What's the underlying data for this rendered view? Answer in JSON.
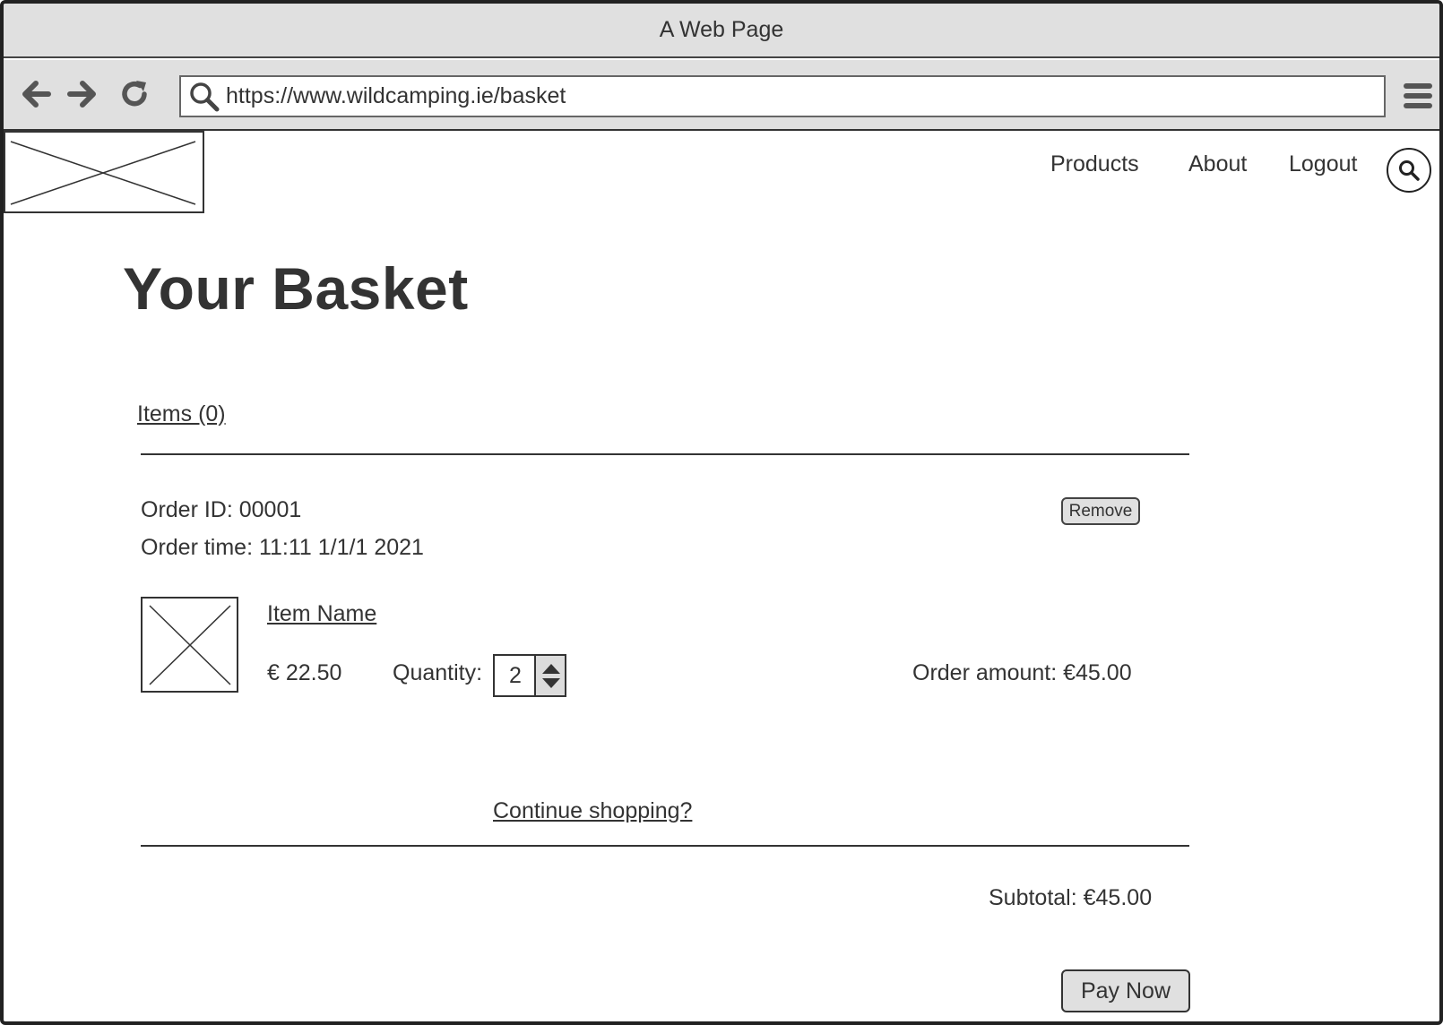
{
  "window": {
    "title": "A Web Page"
  },
  "browser": {
    "url": "https://www.wildcamping.ie/basket",
    "icons": [
      "back-arrow-icon",
      "forward-arrow-icon",
      "reload-icon",
      "search-icon",
      "hamburger-menu-icon"
    ]
  },
  "site": {
    "nav": [
      {
        "label": "Products"
      },
      {
        "label": "About"
      },
      {
        "label": "Logout"
      }
    ],
    "search_icon": "search-icon"
  },
  "page": {
    "title": "Your Basket"
  },
  "basket": {
    "items_label": "Items (0)",
    "order": {
      "id_text": "Order ID: 00001",
      "time_text": "Order time: 11:11 1/1/1 2021",
      "remove_label": "Remove"
    },
    "item": {
      "name": "Item Name",
      "price": "€ 22.50",
      "quantity_label": "Quantity:",
      "quantity": "2",
      "order_amount": "Order amount: €45.00"
    },
    "continue_label": "Continue shopping?",
    "subtotal": "Subtotal: €45.00",
    "pay_label": "Pay Now"
  },
  "colors": {
    "chrome": "#e0e0e0",
    "ink": "#333333",
    "border": "#222222"
  }
}
